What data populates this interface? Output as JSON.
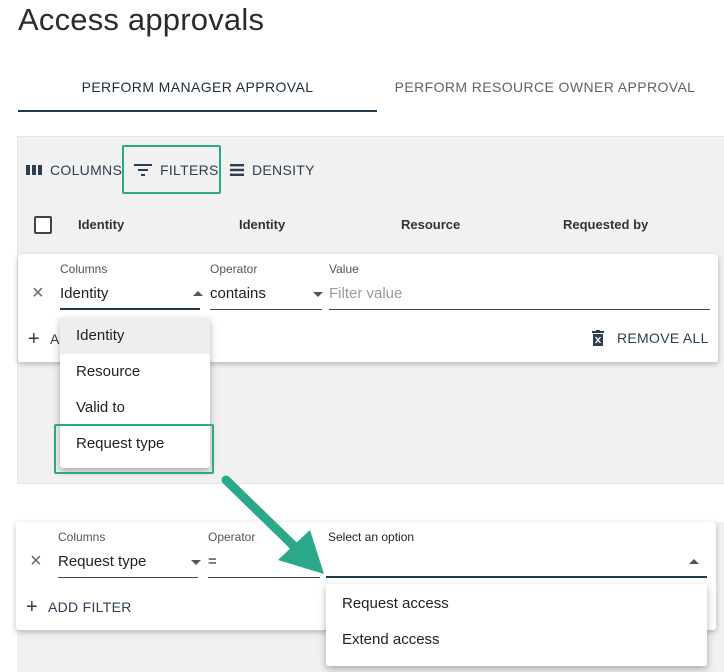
{
  "page": {
    "title": "Access approvals"
  },
  "tabs": [
    {
      "label": "PERFORM MANAGER APPROVAL",
      "active": true
    },
    {
      "label": "PERFORM RESOURCE OWNER APPROVAL",
      "active": false
    }
  ],
  "toolbar": {
    "columns_label": "COLUMNS",
    "filters_label": "FILTERS",
    "density_label": "DENSITY"
  },
  "table": {
    "headers": [
      "Identity",
      "Identity",
      "Resource",
      "Requested by"
    ]
  },
  "filter_top": {
    "columns_label": "Columns",
    "columns_value": "Identity",
    "operator_label": "Operator",
    "operator_value": "contains",
    "value_label": "Value",
    "value_placeholder": "Filter value",
    "add_partial": "A",
    "remove_all_label": "REMOVE ALL"
  },
  "columns_menu": {
    "items": [
      "Identity",
      "Resource",
      "Valid to",
      "Request type"
    ],
    "active_index": 0
  },
  "filter_bottom": {
    "columns_label": "Columns",
    "columns_value": "Request type",
    "operator_label": "Operator",
    "operator_value": "=",
    "select_label": "Select an option",
    "add_filter_label": "ADD FILTER"
  },
  "options_menu": {
    "items": [
      "Request access",
      "Extend access"
    ]
  },
  "colors": {
    "highlight": "#2aa889",
    "accent": "#1e3a4d"
  }
}
